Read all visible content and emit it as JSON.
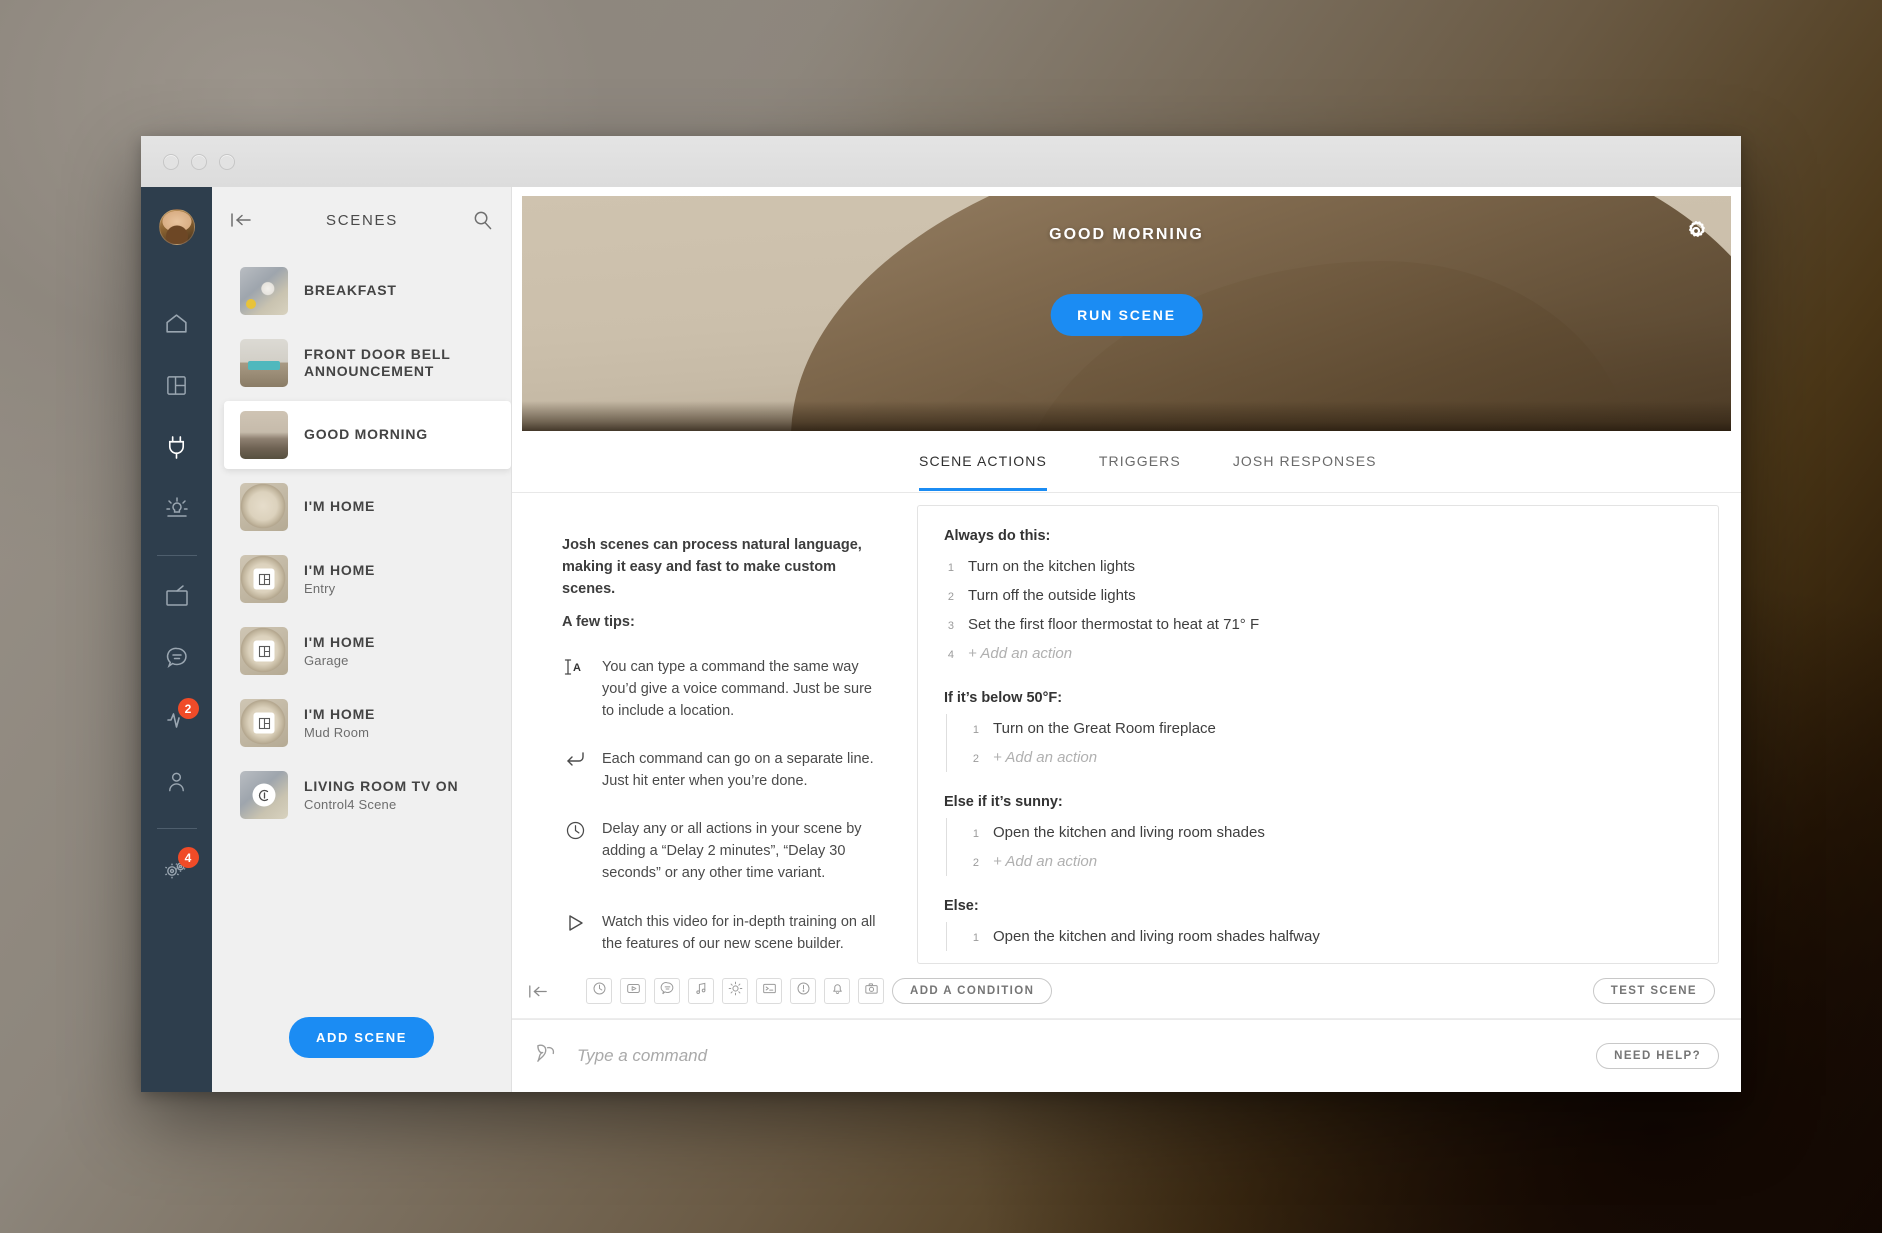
{
  "window": {
    "traffic_lights": [
      "close",
      "minimize",
      "maximize"
    ]
  },
  "rail": {
    "avatar_name": "user-avatar",
    "items": [
      {
        "icon": "home-icon",
        "badge": null,
        "active": false
      },
      {
        "icon": "layout-dashboard-icon",
        "badge": null,
        "active": false
      },
      {
        "icon": "plug-icon",
        "badge": null,
        "active": true
      },
      {
        "icon": "light-bulb-icon",
        "badge": null,
        "active": false
      },
      {
        "icon": "television-icon",
        "badge": null,
        "active": false
      },
      {
        "icon": "intercom-icon",
        "badge": null,
        "active": false
      },
      {
        "icon": "vitals-icon",
        "badge": "2",
        "active": false
      },
      {
        "icon": "person-icon",
        "badge": null,
        "active": false
      },
      {
        "icon": "settings-gears-icon",
        "badge": "4",
        "active": false
      }
    ]
  },
  "scenes": {
    "title": "SCENES",
    "back_icon": "collapse-left-icon",
    "search_icon": "search-icon",
    "add_button": "ADD SCENE",
    "items": [
      {
        "name": "BREAKFAST",
        "sub": "",
        "thumb": "th-breakfast",
        "overlay": "",
        "selected": false
      },
      {
        "name": "FRONT DOOR BELL ANNOUNCEMENT",
        "sub": "",
        "thumb": "th-door",
        "overlay": "",
        "selected": false
      },
      {
        "name": "GOOD MORNING",
        "sub": "",
        "thumb": "th-morning",
        "overlay": "",
        "selected": true
      },
      {
        "name": "I'M HOME",
        "sub": "",
        "thumb": "th-watch",
        "overlay": "",
        "selected": false
      },
      {
        "name": "I'M HOME",
        "sub": "Entry",
        "thumb": "th-watch",
        "overlay": "room",
        "selected": false
      },
      {
        "name": "I'M HOME",
        "sub": "Garage",
        "thumb": "th-watch",
        "overlay": "room",
        "selected": false
      },
      {
        "name": "I'M HOME",
        "sub": "Mud Room",
        "thumb": "th-watch",
        "overlay": "room",
        "selected": false
      },
      {
        "name": "LIVING ROOM TV ON",
        "sub": "Control4 Scene",
        "thumb": "th-c4",
        "overlay": "c4",
        "selected": false
      }
    ]
  },
  "hero": {
    "title": "GOOD MORNING",
    "run_button": "RUN SCENE",
    "settings_icon": "gear-icon"
  },
  "tabs": [
    {
      "label": "SCENE ACTIONS",
      "active": true
    },
    {
      "label": "TRIGGERS",
      "active": false
    },
    {
      "label": "JOSH RESPONSES",
      "active": false
    }
  ],
  "tips": {
    "lead": "Josh scenes can process natural language, making it easy and fast to make custom scenes.",
    "sub": "A few tips:",
    "items": [
      {
        "icon": "text-cursor-icon",
        "text": "You can type a command the same way you’d give a voice command. Just be sure to include a location."
      },
      {
        "icon": "enter-return-icon",
        "text": "Each command can go on a separate line. Just hit enter when you’re done."
      },
      {
        "icon": "clock-icon",
        "text": "Delay any or all actions in your scene by adding a “Delay 2 minutes”, “Delay 30 seconds” or any other time variant."
      },
      {
        "icon": "play-triangle-icon",
        "text": "Watch this video for in-depth training on all the features of our new scene builder."
      }
    ]
  },
  "scene_actions": {
    "groups": [
      {
        "heading": "Always do this:",
        "nested": false,
        "rows": [
          {
            "num": "1",
            "text": "Turn on the kitchen lights",
            "add": false
          },
          {
            "num": "2",
            "text": "Turn off the outside lights",
            "add": false
          },
          {
            "num": "3",
            "text": "Set the first floor thermostat to heat at 71° F",
            "add": false
          },
          {
            "num": "4",
            "text": "+ Add an action",
            "add": true
          }
        ]
      },
      {
        "heading": "If it’s below 50°F:",
        "nested": true,
        "rows": [
          {
            "num": "1",
            "text": "Turn on the Great Room fireplace",
            "add": false
          },
          {
            "num": "2",
            "text": "+ Add an action",
            "add": true
          }
        ]
      },
      {
        "heading": "Else if it’s sunny:",
        "nested": true,
        "rows": [
          {
            "num": "1",
            "text": "Open the kitchen and living room shades",
            "add": false
          },
          {
            "num": "2",
            "text": "+ Add an action",
            "add": true
          }
        ]
      },
      {
        "heading": "Else:",
        "nested": true,
        "rows": [
          {
            "num": "1",
            "text": "Open the kitchen and living room shades halfway",
            "add": false
          }
        ]
      }
    ]
  },
  "toolbar": {
    "collapse_icon": "collapse-left-icon",
    "icons": [
      "clock-icon",
      "video-icon",
      "message-icon",
      "music-note-icon",
      "brightness-icon",
      "terminal-icon",
      "alert-icon",
      "bell-icon",
      "camera-icon"
    ],
    "add_condition": "ADD A CONDITION",
    "test_scene": "TEST SCENE"
  },
  "command_bar": {
    "mic_icon": "voice-wave-icon",
    "placeholder": "Type a command",
    "value": "",
    "need_help": "NEED HELP?"
  },
  "colors": {
    "accent_blue": "#1b8cf3",
    "rail_navy": "#2e3e4d",
    "badge_red": "#f04b28",
    "panel_grey": "#f0f0f0"
  }
}
